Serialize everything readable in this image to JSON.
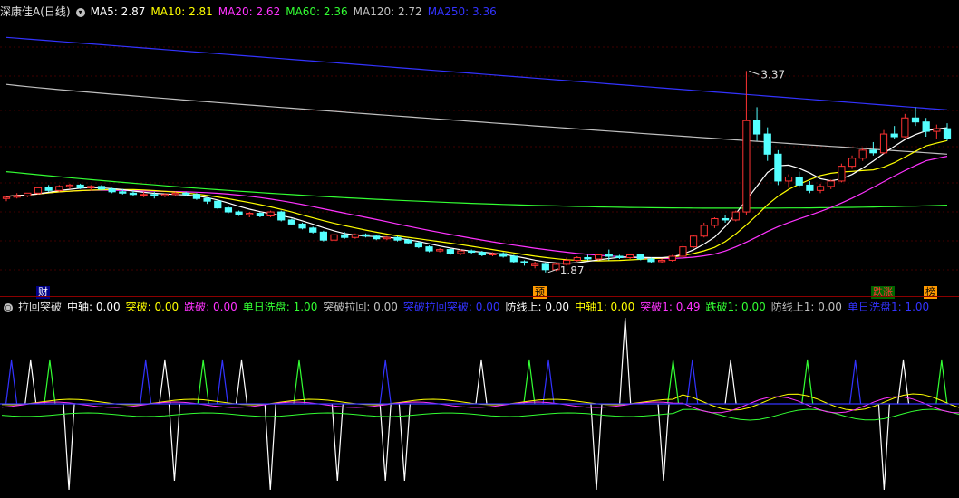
{
  "header": {
    "stock_name": "深康佳A",
    "period": "(日线)",
    "ma_labels": [
      {
        "text": "MA5: 2.87",
        "color": "#ffffff"
      },
      {
        "text": "MA10: 2.81",
        "color": "#ffff00"
      },
      {
        "text": "MA20: 2.62",
        "color": "#ff33ff"
      },
      {
        "text": "MA60: 2.36",
        "color": "#33ff33"
      },
      {
        "text": "MA120: 2.72",
        "color": "#c0c0c0"
      },
      {
        "text": "MA250: 3.36",
        "color": "#3333ff"
      }
    ]
  },
  "markers": {
    "cai": "财",
    "yu": "预",
    "dieting": "跌涨",
    "bang": "榜"
  },
  "chart_data": {
    "type": "candlestick",
    "price_high_label": "3.37",
    "price_low_label": "1.87",
    "candles": [
      [
        2.42,
        2.43,
        2.4,
        2.43
      ],
      [
        2.43,
        2.46,
        2.42,
        2.44
      ],
      [
        2.44,
        2.46,
        2.43,
        2.46
      ],
      [
        2.46,
        2.5,
        2.45,
        2.5
      ],
      [
        2.5,
        2.52,
        2.47,
        2.48
      ],
      [
        2.48,
        2.52,
        2.47,
        2.51
      ],
      [
        2.51,
        2.53,
        2.49,
        2.52
      ],
      [
        2.52,
        2.53,
        2.49,
        2.5
      ],
      [
        2.5,
        2.52,
        2.48,
        2.51
      ],
      [
        2.51,
        2.52,
        2.48,
        2.49
      ],
      [
        2.49,
        2.5,
        2.46,
        2.47
      ],
      [
        2.47,
        2.49,
        2.45,
        2.46
      ],
      [
        2.46,
        2.48,
        2.44,
        2.45
      ],
      [
        2.45,
        2.47,
        2.43,
        2.45
      ],
      [
        2.45,
        2.47,
        2.42,
        2.44
      ],
      [
        2.44,
        2.46,
        2.43,
        2.45
      ],
      [
        2.45,
        2.47,
        2.44,
        2.46
      ],
      [
        2.46,
        2.47,
        2.44,
        2.45
      ],
      [
        2.45,
        2.46,
        2.41,
        2.42
      ],
      [
        2.42,
        2.43,
        2.38,
        2.4
      ],
      [
        2.4,
        2.41,
        2.34,
        2.35
      ],
      [
        2.35,
        2.36,
        2.31,
        2.32
      ],
      [
        2.32,
        2.33,
        2.29,
        2.3
      ],
      [
        2.3,
        2.32,
        2.28,
        2.31
      ],
      [
        2.31,
        2.32,
        2.28,
        2.29
      ],
      [
        2.29,
        2.33,
        2.28,
        2.32
      ],
      [
        2.32,
        2.33,
        2.25,
        2.26
      ],
      [
        2.26,
        2.27,
        2.22,
        2.23
      ],
      [
        2.23,
        2.24,
        2.19,
        2.2
      ],
      [
        2.2,
        2.21,
        2.16,
        2.17
      ],
      [
        2.17,
        2.18,
        2.1,
        2.11
      ],
      [
        2.11,
        2.16,
        2.1,
        2.15
      ],
      [
        2.15,
        2.17,
        2.12,
        2.13
      ],
      [
        2.13,
        2.16,
        2.12,
        2.15
      ],
      [
        2.15,
        2.16,
        2.13,
        2.14
      ],
      [
        2.14,
        2.15,
        2.11,
        2.12
      ],
      [
        2.12,
        2.14,
        2.11,
        2.13
      ],
      [
        2.13,
        2.14,
        2.1,
        2.11
      ],
      [
        2.11,
        2.12,
        2.08,
        2.09
      ],
      [
        2.09,
        2.1,
        2.05,
        2.06
      ],
      [
        2.06,
        2.07,
        2.02,
        2.03
      ],
      [
        2.03,
        2.05,
        2.02,
        2.04
      ],
      [
        2.04,
        2.05,
        2.0,
        2.01
      ],
      [
        2.01,
        2.04,
        2.0,
        2.03
      ],
      [
        2.03,
        2.04,
        2.01,
        2.02
      ],
      [
        2.02,
        2.03,
        1.99,
        2.0
      ],
      [
        2.0,
        2.02,
        1.99,
        2.01
      ],
      [
        2.01,
        2.02,
        1.98,
        1.99
      ],
      [
        1.99,
        2.0,
        1.94,
        1.95
      ],
      [
        1.95,
        1.96,
        1.92,
        1.94
      ],
      [
        1.92,
        1.95,
        1.9,
        1.93
      ],
      [
        1.93,
        1.94,
        1.87,
        1.89
      ],
      [
        1.89,
        1.94,
        1.88,
        1.93
      ],
      [
        1.93,
        1.98,
        1.92,
        1.96
      ],
      [
        1.96,
        1.99,
        1.95,
        1.98
      ],
      [
        1.98,
        2.0,
        1.96,
        1.97
      ],
      [
        1.97,
        2.01,
        1.96,
        2.0
      ],
      [
        2.0,
        2.04,
        1.96,
        1.99
      ],
      [
        1.99,
        2.0,
        1.97,
        1.98
      ],
      [
        1.98,
        2.01,
        1.97,
        2.0
      ],
      [
        2.0,
        2.01,
        1.96,
        1.97
      ],
      [
        1.97,
        1.98,
        1.94,
        1.95
      ],
      [
        1.95,
        1.97,
        1.94,
        1.96
      ],
      [
        1.96,
        2.0,
        1.95,
        1.99
      ],
      [
        1.99,
        2.08,
        1.98,
        2.06
      ],
      [
        2.06,
        2.15,
        2.05,
        2.14
      ],
      [
        2.14,
        2.24,
        2.13,
        2.22
      ],
      [
        2.22,
        2.28,
        2.2,
        2.27
      ],
      [
        2.27,
        2.3,
        2.24,
        2.26
      ],
      [
        2.26,
        2.33,
        2.25,
        2.32
      ],
      [
        2.32,
        3.37,
        2.3,
        3.0
      ],
      [
        3.0,
        3.1,
        2.85,
        2.9
      ],
      [
        2.9,
        2.95,
        2.7,
        2.75
      ],
      [
        2.75,
        2.78,
        2.52,
        2.55
      ],
      [
        2.55,
        2.6,
        2.5,
        2.58
      ],
      [
        2.58,
        2.62,
        2.5,
        2.52
      ],
      [
        2.52,
        2.55,
        2.46,
        2.48
      ],
      [
        2.48,
        2.53,
        2.46,
        2.51
      ],
      [
        2.51,
        2.56,
        2.49,
        2.55
      ],
      [
        2.55,
        2.68,
        2.54,
        2.66
      ],
      [
        2.66,
        2.74,
        2.64,
        2.72
      ],
      [
        2.72,
        2.8,
        2.7,
        2.78
      ],
      [
        2.78,
        2.84,
        2.74,
        2.76
      ],
      [
        2.76,
        2.93,
        2.75,
        2.9
      ],
      [
        2.9,
        2.96,
        2.86,
        2.88
      ],
      [
        2.88,
        3.05,
        2.87,
        3.02
      ],
      [
        3.02,
        3.1,
        2.96,
        2.99
      ],
      [
        2.99,
        3.02,
        2.88,
        2.92
      ],
      [
        2.92,
        2.97,
        2.86,
        2.94
      ],
      [
        2.94,
        2.98,
        2.85,
        2.87
      ]
    ]
  },
  "indicator": {
    "name": "拉回突破",
    "labels": [
      {
        "text": "中轴: 0.00",
        "color": "#ffffff"
      },
      {
        "text": "突破: 0.00",
        "color": "#ffff00"
      },
      {
        "text": "跌破: 0.00",
        "color": "#ff33ff"
      },
      {
        "text": "单日洗盘: 1.00",
        "color": "#33ff33"
      },
      {
        "text": "突破拉回: 0.00",
        "color": "#c0c0c0"
      },
      {
        "text": "突破拉回突破: 0.00",
        "color": "#3333ff"
      },
      {
        "text": "防线上: 0.00",
        "color": "#ffffff"
      },
      {
        "text": "中轴1: 0.00",
        "color": "#ffff00"
      },
      {
        "text": "突破1: 0.49",
        "color": "#ff33ff"
      },
      {
        "text": "跌破1: 0.00",
        "color": "#33ff33"
      },
      {
        "text": "防线上1: 0.00",
        "color": "#c0c0c0"
      },
      {
        "text": "单日洗盘1: 1.00",
        "color": "#3333ff"
      }
    ]
  }
}
